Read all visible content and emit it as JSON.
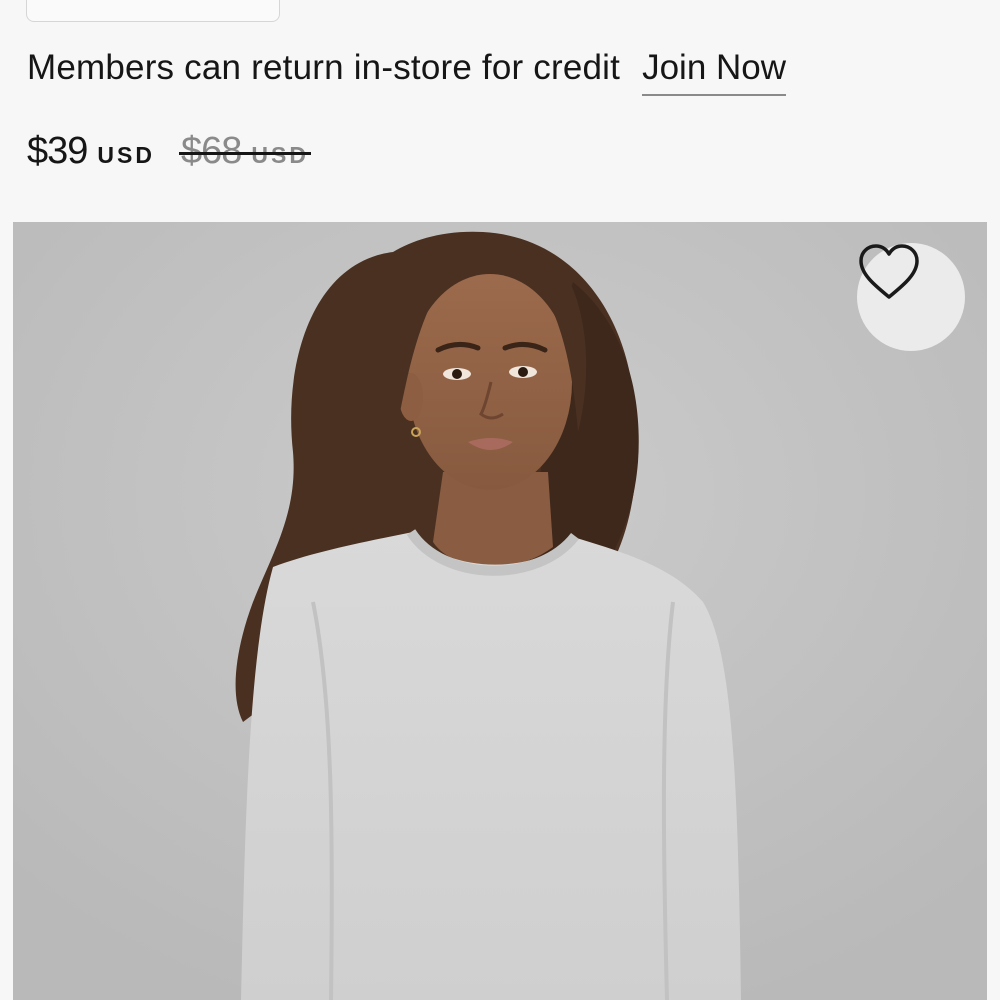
{
  "promo": {
    "text": "Members can return in-store for credit",
    "join_label": "Join Now"
  },
  "price": {
    "current": "$39",
    "current_currency": "USD",
    "original": "$68",
    "original_currency": "USD"
  },
  "product_image": {
    "favorite_icon": "heart-outline-icon"
  },
  "colors": {
    "background": "#f7f7f7",
    "text": "#161616",
    "strikethrough_text": "#8a8a8a",
    "favorite_button_bg": "#ebebeb"
  }
}
